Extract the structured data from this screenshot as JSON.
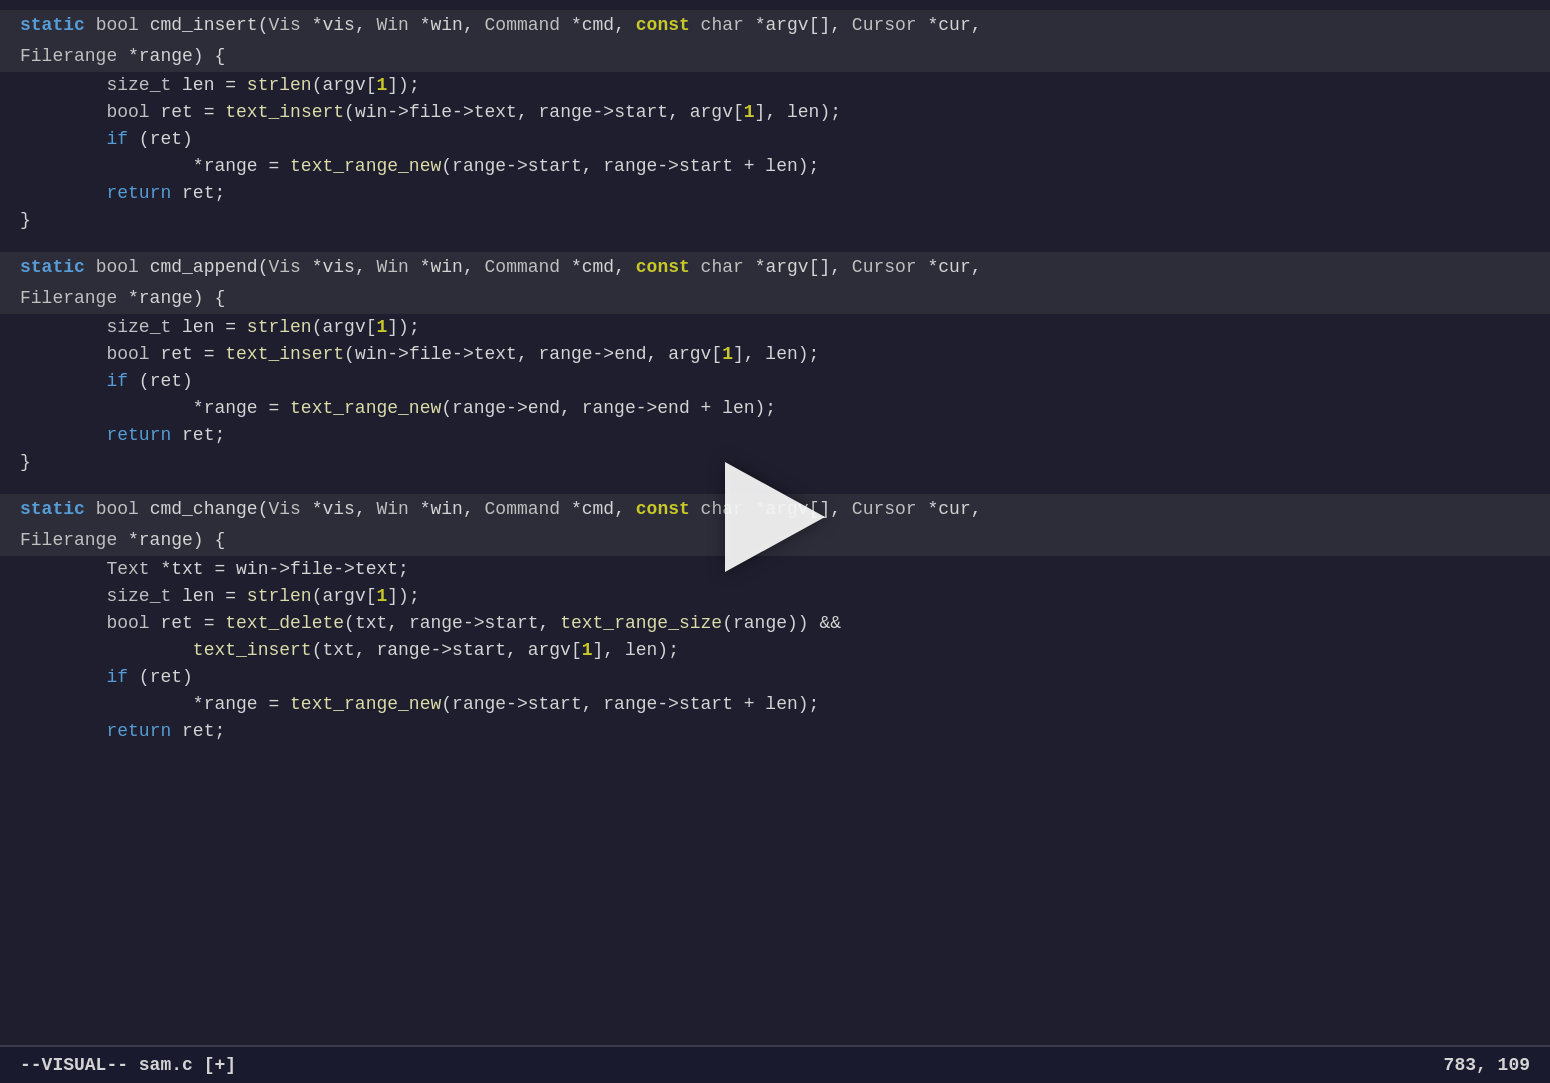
{
  "editor": {
    "background": "#1e1e2e",
    "status_bar": {
      "left": "--VISUAL-- sam.c [+]",
      "right": "783, 109"
    },
    "code_blocks": [
      {
        "id": "block1",
        "sig_line1": "static bool cmd_insert(Vis *vis, Win *win, Command *cmd, const char *argv[], Cursor *cur,",
        "sig_line2": "Filerange *range) {",
        "body": [
          "        size_t len = strlen(argv[1]);",
          "        bool ret = text_insert(win->file->text, range->start, argv[1], len);",
          "        if (ret)",
          "                *range = text_range_new(range->start, range->start + len);",
          "        return ret;",
          "}"
        ]
      },
      {
        "id": "block2",
        "sig_line1": "static bool cmd_append(Vis *vis, Win *win, Command *cmd, const char *argv[], Cursor *cur,",
        "sig_line2": "Filerange *range) {",
        "body": [
          "        size_t len = strlen(argv[1]);",
          "        bool ret = text_insert(win->file->text, range->end, argv[1], len);",
          "        if (ret)",
          "                *range = text_range_new(range->end, range->end + len);",
          "        return ret;",
          "}"
        ]
      },
      {
        "id": "block3",
        "sig_line1": "static bool cmd_change(Vis *vis, Win *win, Command *cmd, const char *argv[], Cursor *cur,",
        "sig_line2": "Filerange *range) {",
        "body": [
          "        Text *txt = win->file->text;",
          "        size_t len = strlen(argv[1]);",
          "        bool ret = text_delete(txt, range->start, text_range_size(range)) &&",
          "                text_insert(txt, range->start, argv[1], len);",
          "        if (ret)",
          "                *range = text_range_new(range->start, range->start + len);",
          "        return ret;"
        ]
      }
    ]
  }
}
